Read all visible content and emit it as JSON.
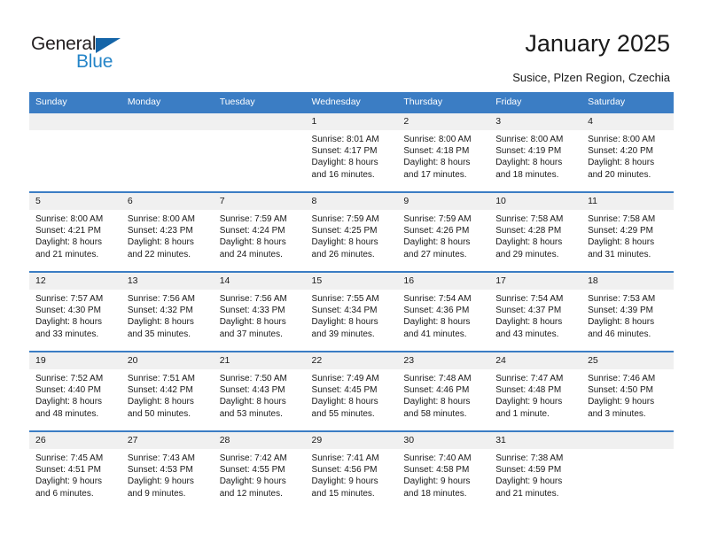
{
  "brand": {
    "name_dark": "General",
    "name_light": "Blue",
    "accent_dark": "#1565a8",
    "accent_light": "#2585c8"
  },
  "header": {
    "title": "January 2025",
    "subtitle": "Susice, Plzen Region, Czechia"
  },
  "theme": {
    "header_blue": "#3b7dc4",
    "daynum_band": "#f0f0f0",
    "text": "#1a1a1a"
  },
  "weekdays": [
    "Sunday",
    "Monday",
    "Tuesday",
    "Wednesday",
    "Thursday",
    "Friday",
    "Saturday"
  ],
  "weeks": [
    [
      {
        "day": "",
        "sunrise": "",
        "sunset": "",
        "daylight1": "",
        "daylight2": ""
      },
      {
        "day": "",
        "sunrise": "",
        "sunset": "",
        "daylight1": "",
        "daylight2": ""
      },
      {
        "day": "",
        "sunrise": "",
        "sunset": "",
        "daylight1": "",
        "daylight2": ""
      },
      {
        "day": "1",
        "sunrise": "Sunrise: 8:01 AM",
        "sunset": "Sunset: 4:17 PM",
        "daylight1": "Daylight: 8 hours",
        "daylight2": "and 16 minutes."
      },
      {
        "day": "2",
        "sunrise": "Sunrise: 8:00 AM",
        "sunset": "Sunset: 4:18 PM",
        "daylight1": "Daylight: 8 hours",
        "daylight2": "and 17 minutes."
      },
      {
        "day": "3",
        "sunrise": "Sunrise: 8:00 AM",
        "sunset": "Sunset: 4:19 PM",
        "daylight1": "Daylight: 8 hours",
        "daylight2": "and 18 minutes."
      },
      {
        "day": "4",
        "sunrise": "Sunrise: 8:00 AM",
        "sunset": "Sunset: 4:20 PM",
        "daylight1": "Daylight: 8 hours",
        "daylight2": "and 20 minutes."
      }
    ],
    [
      {
        "day": "5",
        "sunrise": "Sunrise: 8:00 AM",
        "sunset": "Sunset: 4:21 PM",
        "daylight1": "Daylight: 8 hours",
        "daylight2": "and 21 minutes."
      },
      {
        "day": "6",
        "sunrise": "Sunrise: 8:00 AM",
        "sunset": "Sunset: 4:23 PM",
        "daylight1": "Daylight: 8 hours",
        "daylight2": "and 22 minutes."
      },
      {
        "day": "7",
        "sunrise": "Sunrise: 7:59 AM",
        "sunset": "Sunset: 4:24 PM",
        "daylight1": "Daylight: 8 hours",
        "daylight2": "and 24 minutes."
      },
      {
        "day": "8",
        "sunrise": "Sunrise: 7:59 AM",
        "sunset": "Sunset: 4:25 PM",
        "daylight1": "Daylight: 8 hours",
        "daylight2": "and 26 minutes."
      },
      {
        "day": "9",
        "sunrise": "Sunrise: 7:59 AM",
        "sunset": "Sunset: 4:26 PM",
        "daylight1": "Daylight: 8 hours",
        "daylight2": "and 27 minutes."
      },
      {
        "day": "10",
        "sunrise": "Sunrise: 7:58 AM",
        "sunset": "Sunset: 4:28 PM",
        "daylight1": "Daylight: 8 hours",
        "daylight2": "and 29 minutes."
      },
      {
        "day": "11",
        "sunrise": "Sunrise: 7:58 AM",
        "sunset": "Sunset: 4:29 PM",
        "daylight1": "Daylight: 8 hours",
        "daylight2": "and 31 minutes."
      }
    ],
    [
      {
        "day": "12",
        "sunrise": "Sunrise: 7:57 AM",
        "sunset": "Sunset: 4:30 PM",
        "daylight1": "Daylight: 8 hours",
        "daylight2": "and 33 minutes."
      },
      {
        "day": "13",
        "sunrise": "Sunrise: 7:56 AM",
        "sunset": "Sunset: 4:32 PM",
        "daylight1": "Daylight: 8 hours",
        "daylight2": "and 35 minutes."
      },
      {
        "day": "14",
        "sunrise": "Sunrise: 7:56 AM",
        "sunset": "Sunset: 4:33 PM",
        "daylight1": "Daylight: 8 hours",
        "daylight2": "and 37 minutes."
      },
      {
        "day": "15",
        "sunrise": "Sunrise: 7:55 AM",
        "sunset": "Sunset: 4:34 PM",
        "daylight1": "Daylight: 8 hours",
        "daylight2": "and 39 minutes."
      },
      {
        "day": "16",
        "sunrise": "Sunrise: 7:54 AM",
        "sunset": "Sunset: 4:36 PM",
        "daylight1": "Daylight: 8 hours",
        "daylight2": "and 41 minutes."
      },
      {
        "day": "17",
        "sunrise": "Sunrise: 7:54 AM",
        "sunset": "Sunset: 4:37 PM",
        "daylight1": "Daylight: 8 hours",
        "daylight2": "and 43 minutes."
      },
      {
        "day": "18",
        "sunrise": "Sunrise: 7:53 AM",
        "sunset": "Sunset: 4:39 PM",
        "daylight1": "Daylight: 8 hours",
        "daylight2": "and 46 minutes."
      }
    ],
    [
      {
        "day": "19",
        "sunrise": "Sunrise: 7:52 AM",
        "sunset": "Sunset: 4:40 PM",
        "daylight1": "Daylight: 8 hours",
        "daylight2": "and 48 minutes."
      },
      {
        "day": "20",
        "sunrise": "Sunrise: 7:51 AM",
        "sunset": "Sunset: 4:42 PM",
        "daylight1": "Daylight: 8 hours",
        "daylight2": "and 50 minutes."
      },
      {
        "day": "21",
        "sunrise": "Sunrise: 7:50 AM",
        "sunset": "Sunset: 4:43 PM",
        "daylight1": "Daylight: 8 hours",
        "daylight2": "and 53 minutes."
      },
      {
        "day": "22",
        "sunrise": "Sunrise: 7:49 AM",
        "sunset": "Sunset: 4:45 PM",
        "daylight1": "Daylight: 8 hours",
        "daylight2": "and 55 minutes."
      },
      {
        "day": "23",
        "sunrise": "Sunrise: 7:48 AM",
        "sunset": "Sunset: 4:46 PM",
        "daylight1": "Daylight: 8 hours",
        "daylight2": "and 58 minutes."
      },
      {
        "day": "24",
        "sunrise": "Sunrise: 7:47 AM",
        "sunset": "Sunset: 4:48 PM",
        "daylight1": "Daylight: 9 hours",
        "daylight2": "and 1 minute."
      },
      {
        "day": "25",
        "sunrise": "Sunrise: 7:46 AM",
        "sunset": "Sunset: 4:50 PM",
        "daylight1": "Daylight: 9 hours",
        "daylight2": "and 3 minutes."
      }
    ],
    [
      {
        "day": "26",
        "sunrise": "Sunrise: 7:45 AM",
        "sunset": "Sunset: 4:51 PM",
        "daylight1": "Daylight: 9 hours",
        "daylight2": "and 6 minutes."
      },
      {
        "day": "27",
        "sunrise": "Sunrise: 7:43 AM",
        "sunset": "Sunset: 4:53 PM",
        "daylight1": "Daylight: 9 hours",
        "daylight2": "and 9 minutes."
      },
      {
        "day": "28",
        "sunrise": "Sunrise: 7:42 AM",
        "sunset": "Sunset: 4:55 PM",
        "daylight1": "Daylight: 9 hours",
        "daylight2": "and 12 minutes."
      },
      {
        "day": "29",
        "sunrise": "Sunrise: 7:41 AM",
        "sunset": "Sunset: 4:56 PM",
        "daylight1": "Daylight: 9 hours",
        "daylight2": "and 15 minutes."
      },
      {
        "day": "30",
        "sunrise": "Sunrise: 7:40 AM",
        "sunset": "Sunset: 4:58 PM",
        "daylight1": "Daylight: 9 hours",
        "daylight2": "and 18 minutes."
      },
      {
        "day": "31",
        "sunrise": "Sunrise: 7:38 AM",
        "sunset": "Sunset: 4:59 PM",
        "daylight1": "Daylight: 9 hours",
        "daylight2": "and 21 minutes."
      },
      {
        "day": "",
        "sunrise": "",
        "sunset": "",
        "daylight1": "",
        "daylight2": ""
      }
    ]
  ]
}
